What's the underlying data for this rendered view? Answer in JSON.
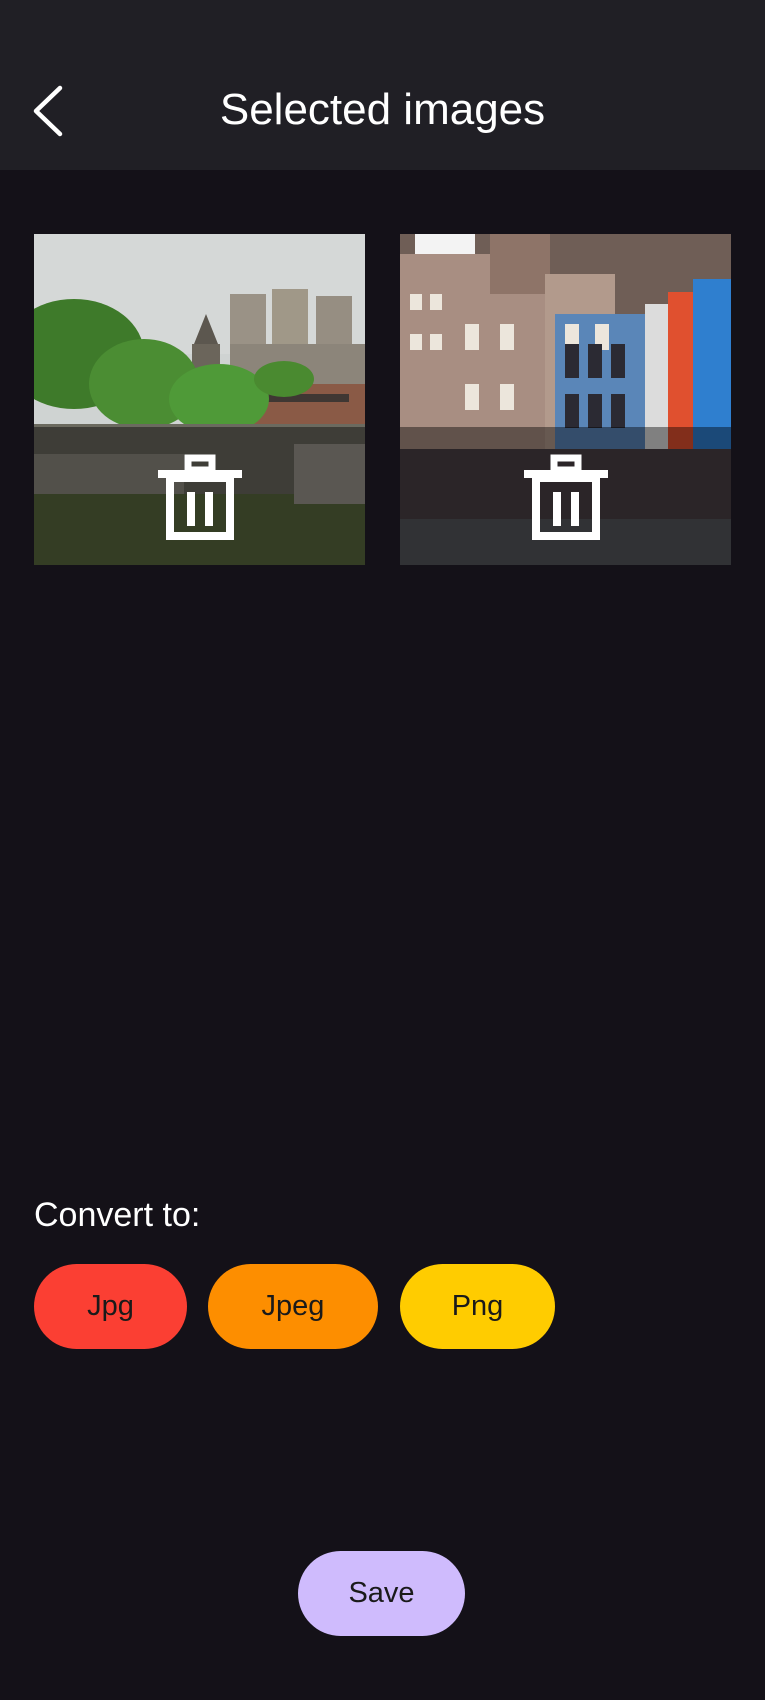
{
  "header": {
    "title": "Selected images",
    "back_icon": "chevron-left-icon"
  },
  "images": [
    {
      "description": "cityscape photo with cathedral and trees",
      "delete_icon": "trash-icon"
    },
    {
      "description": "street with colorful buildings",
      "delete_icon": "trash-icon"
    }
  ],
  "convert": {
    "label": "Convert to:",
    "options": [
      {
        "label": "Jpg",
        "color": "#fb3f33"
      },
      {
        "label": "Jpeg",
        "color": "#fd8e00"
      },
      {
        "label": "Png",
        "color": "#ffcc00"
      }
    ]
  },
  "save": {
    "label": "Save",
    "color": "#cfbbfd"
  },
  "theme": {
    "background": "#141118",
    "appbar": "#201f25"
  }
}
